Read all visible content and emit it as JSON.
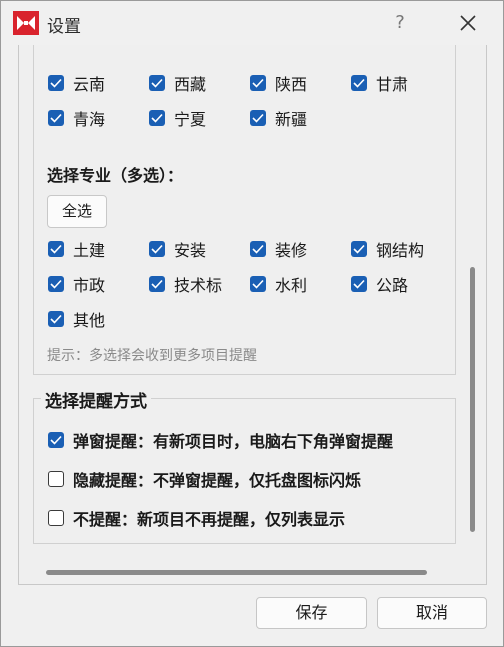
{
  "window": {
    "title": "设置",
    "help_label": "?"
  },
  "icons": {
    "logo": "app-logo-icon",
    "close": "close-icon",
    "check": "checkmark-icon"
  },
  "colors": {
    "accent": "#1a5fb4",
    "logo_red": "#d9232d"
  },
  "regions": [
    {
      "label": "云南",
      "checked": true
    },
    {
      "label": "西藏",
      "checked": true
    },
    {
      "label": "陕西",
      "checked": true
    },
    {
      "label": "甘肃",
      "checked": true
    },
    {
      "label": "青海",
      "checked": true
    },
    {
      "label": "宁夏",
      "checked": true
    },
    {
      "label": "新疆",
      "checked": true
    }
  ],
  "specialty": {
    "label": "选择专业（多选）：",
    "select_all": "全选",
    "items": [
      {
        "label": "土建",
        "checked": true
      },
      {
        "label": "安装",
        "checked": true
      },
      {
        "label": "装修",
        "checked": true
      },
      {
        "label": "钢结构",
        "checked": true
      },
      {
        "label": "市政",
        "checked": true
      },
      {
        "label": "技术标",
        "checked": true
      },
      {
        "label": "水利",
        "checked": true
      },
      {
        "label": "公路",
        "checked": true
      },
      {
        "label": "其他",
        "checked": true
      }
    ],
    "hint": "提示：多选择会收到更多项目提醒"
  },
  "reminder": {
    "title": "选择提醒方式",
    "options": [
      {
        "label": "弹窗提醒：有新项目时，电脑右下角弹窗提醒",
        "checked": true
      },
      {
        "label": "隐藏提醒：不弹窗提醒，仅托盘图标闪烁",
        "checked": false
      },
      {
        "label": "不提醒：新项目不再提醒，仅列表显示",
        "checked": false
      }
    ]
  },
  "buttons": {
    "save": "保存",
    "cancel": "取消"
  }
}
